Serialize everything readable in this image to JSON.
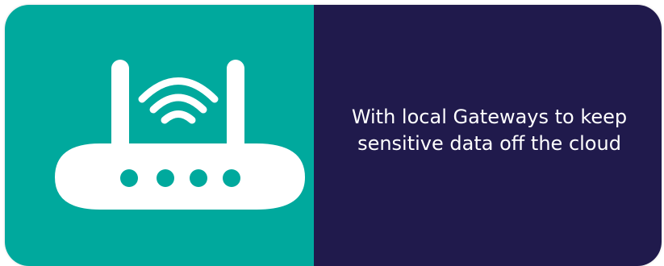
{
  "colors": {
    "icon_panel_bg": "#00a99d",
    "text_panel_bg": "#201a4c",
    "icon_fill": "#ffffff",
    "text_color": "#ffffff"
  },
  "icon": {
    "name": "wifi-router-icon"
  },
  "caption": {
    "text": "With local Gateways to keep sensitive data off the cloud"
  }
}
